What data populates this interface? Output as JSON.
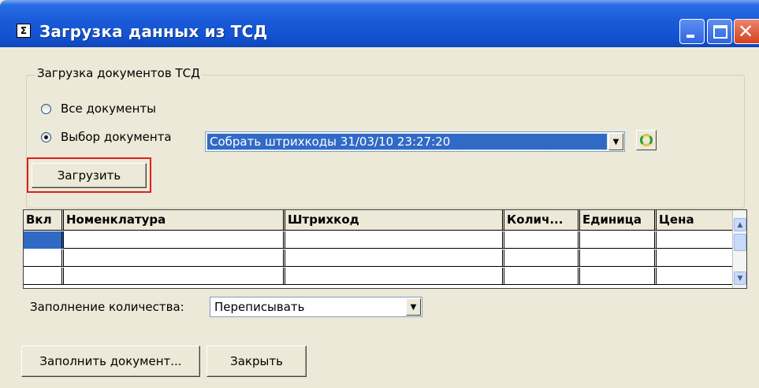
{
  "window": {
    "title": "Загрузка данных из ТСД",
    "app_icon_glyph": "Σ",
    "close_glyph": "✕"
  },
  "load_group": {
    "label": "Загрузка документов ТСД",
    "radio_all": "Все документы",
    "radio_select": "Выбор документа",
    "selected_radio": "radio_select",
    "document_combo_value": "Собрать штрихкоды 31/03/10 23:27:20",
    "load_button": "Загрузить"
  },
  "grid": {
    "columns": [
      "Вкл",
      "Номенклатура",
      "Штрихкод",
      "Колич...",
      "Единица",
      "Цена"
    ],
    "row_count": 3,
    "scroll_up": "▲",
    "scroll_down": "▼"
  },
  "fill_quantity": {
    "label": "Заполнение количества:",
    "value": "Переписывать"
  },
  "footer": {
    "fill_document_button": "Заполнить документ...",
    "close_button": "Закрыть"
  },
  "colors": {
    "titlebar": "#1a5ad8",
    "selection": "#316ac5",
    "highlight_border": "#e0201a",
    "window_bg": "#ece9d8"
  }
}
